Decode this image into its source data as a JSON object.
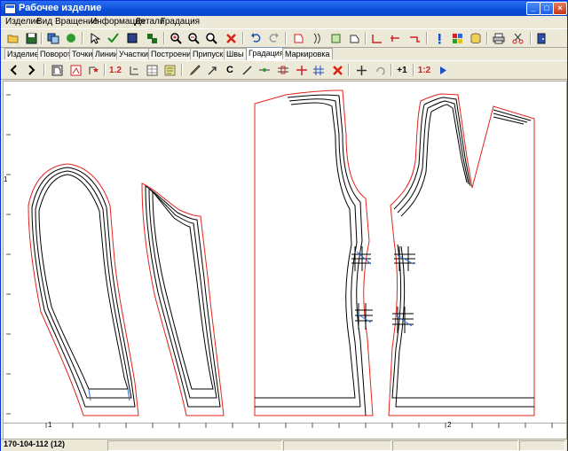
{
  "window": {
    "title": "Рабочее изделие"
  },
  "menu": [
    "Изделие",
    "Вид",
    "Вращение",
    "Информация",
    "Детали",
    "Градация"
  ],
  "tabs": [
    "Изделие",
    "Поворот",
    "Точки",
    "Линии",
    "Участки",
    "Построение",
    "Припуски",
    "Швы",
    "Градация",
    "Маркировка"
  ],
  "active_tab": "Градация",
  "toolbar2": {
    "num_label": "1.2",
    "c_label": "C",
    "plus1_label": "+1",
    "one2_label": "1:2"
  },
  "ruler": {
    "v_mark": "1",
    "h_mark_1": "1",
    "h_mark_2": "2"
  },
  "status": {
    "size_text": "170-104-112 (12)"
  },
  "colors": {
    "accent": "#0a4fd9",
    "outline": "#e2231a",
    "grade_line": "#000000",
    "highlight": "#1e6fd9"
  }
}
